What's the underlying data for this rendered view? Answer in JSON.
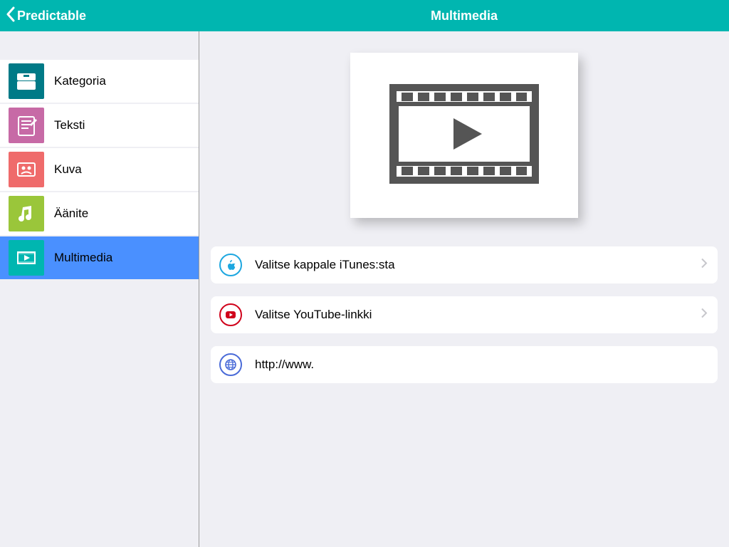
{
  "header": {
    "back_label": "Predictable",
    "title": "Multimedia"
  },
  "sidebar": {
    "items": [
      {
        "label": "Kategoria",
        "icon": "category-icon",
        "color": "#007a87"
      },
      {
        "label": "Teksti",
        "icon": "text-icon",
        "color": "#c76aa6"
      },
      {
        "label": "Kuva",
        "icon": "image-icon",
        "color": "#ef6b6b"
      },
      {
        "label": "Äänite",
        "icon": "audio-icon",
        "color": "#9ac63a"
      },
      {
        "label": "Multimedia",
        "icon": "multimedia-icon",
        "color": "#00b6b0",
        "selected": true
      }
    ]
  },
  "content": {
    "hero_icon": "film-play-icon",
    "options": [
      {
        "label": "Valitse kappale iTunes:sta",
        "icon": "itunes-icon",
        "icon_color": "#1ea7e0",
        "chevron": true
      },
      {
        "label": "Valitse YouTube-linkki",
        "icon": "youtube-icon",
        "icon_color": "#d0021b",
        "chevron": true
      }
    ],
    "url_field": {
      "icon": "globe-icon",
      "icon_color": "#4a6bd8",
      "value": "http://www."
    }
  }
}
